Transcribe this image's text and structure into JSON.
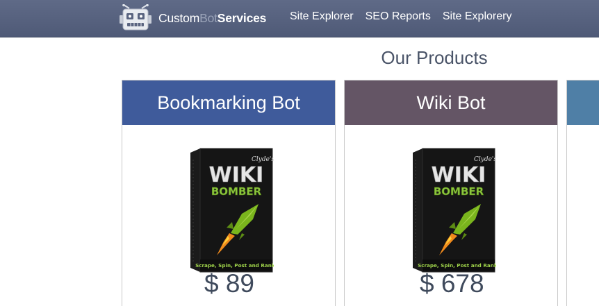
{
  "header": {
    "logo": {
      "word1": "Custom",
      "word2": "Bot",
      "word3": "Services"
    },
    "nav": [
      {
        "label": "Site Explorer"
      },
      {
        "label": "SEO Reports"
      },
      {
        "label": "Site Explorery"
      }
    ]
  },
  "main": {
    "title": "Our Products",
    "products": [
      {
        "name": "Bookmarking Bot",
        "price": "$ 89",
        "header_color": "#3f5b9b",
        "box": {
          "brand": "Clyde's",
          "line1": "WIKI",
          "line2": "BOMBER",
          "tagline": "Scrape, Spin, Post and Rank!"
        }
      },
      {
        "name": "Wiki Bot",
        "price": "$ 678",
        "header_color": "#645565",
        "box": {
          "brand": "Clyde's",
          "line1": "WIKI",
          "line2": "BOMBER",
          "tagline": "Scrape, Spin, Post and Rank!"
        }
      },
      {
        "name": "",
        "price": "",
        "header_color": "#4f7fa6"
      }
    ]
  },
  "colors": {
    "topbar": "#56617e",
    "accent_green": "#7ab51d"
  }
}
